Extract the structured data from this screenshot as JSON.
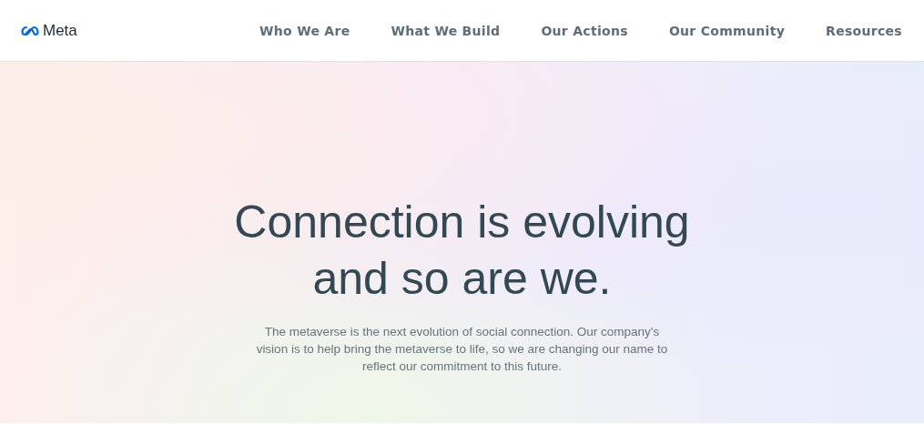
{
  "header": {
    "logo": "Meta",
    "nav": [
      {
        "label": "Who We Are"
      },
      {
        "label": "What We Build"
      },
      {
        "label": "Our Actions"
      },
      {
        "label": "Our Community"
      },
      {
        "label": "Resources"
      }
    ]
  },
  "hero": {
    "headline_lines": [
      "Connection is evolving",
      "and so are we."
    ],
    "body_lines": [
      "The metaverse is the next evolution of social connection. Our company's",
      "vision is to help bring the metaverse to life, so we are changing our name to",
      "reflect our commitment to this future."
    ]
  }
}
